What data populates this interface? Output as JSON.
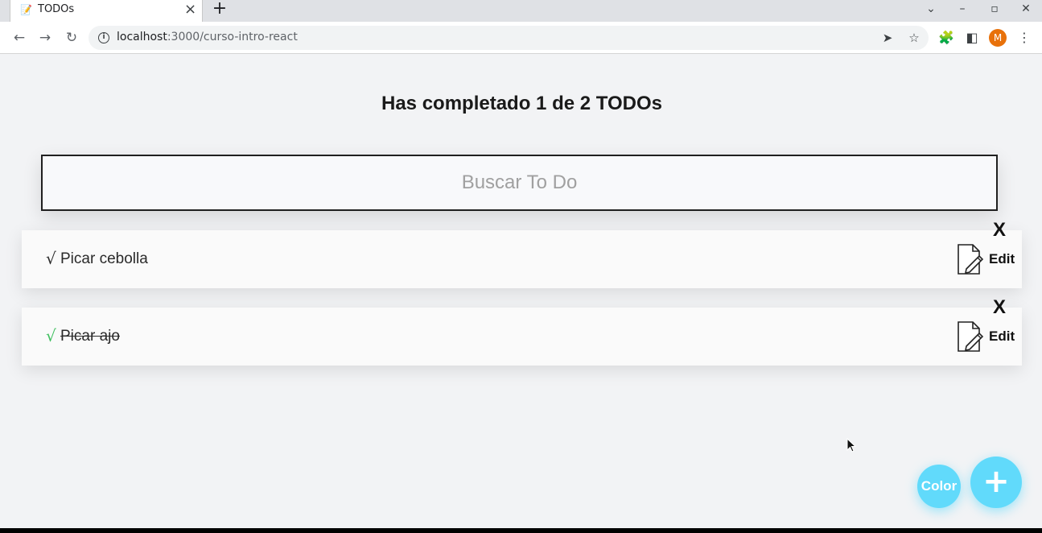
{
  "browser": {
    "tab": {
      "favicon": "memo-icon",
      "title": "TODOs"
    },
    "new_tab_label": "+",
    "url_host": "localhost",
    "url_path": ":3000/curso-intro-react",
    "avatar_letter": "M"
  },
  "app": {
    "counter_text": "Has completado 1 de 2 TODOs",
    "search_placeholder": "Buscar To Do",
    "todos": [
      {
        "check": "√",
        "text": "Picar cebolla",
        "completed": false,
        "delete_label": "X",
        "edit_label": "Edit"
      },
      {
        "check": "√",
        "text": "Picar ajo",
        "completed": true,
        "delete_label": "X",
        "edit_label": "Edit"
      }
    ],
    "color_button_label": "Color",
    "add_button_label": "+"
  },
  "colors": {
    "accent": "#61dafb",
    "completed_check": "#3fbf5f",
    "background": "#f2f3f5"
  }
}
